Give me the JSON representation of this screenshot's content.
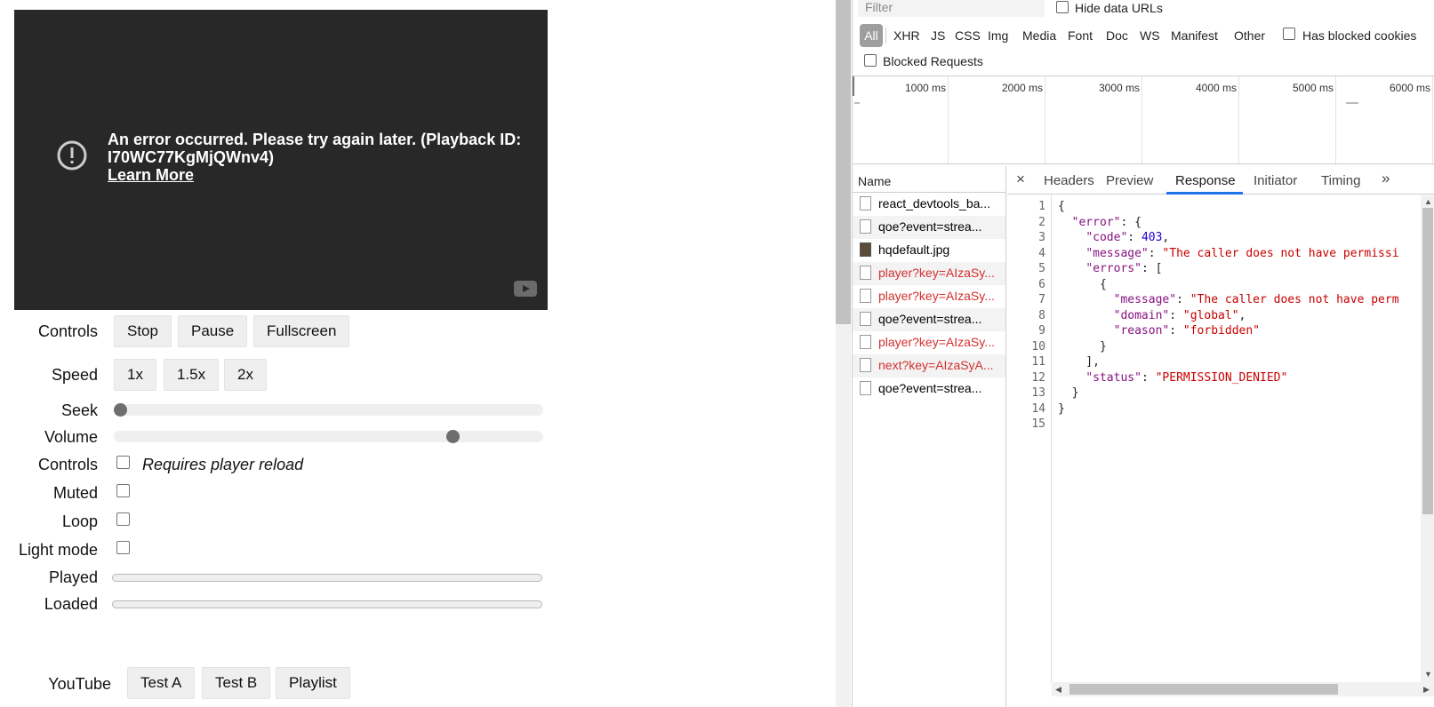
{
  "player": {
    "error_message": "An error occurred. Please try again later. (Playback ID: I70WC77KgMjQWnv4)",
    "learn_more": "Learn More"
  },
  "controls": {
    "label": "Controls",
    "buttons": [
      "Stop",
      "Pause",
      "Fullscreen"
    ]
  },
  "speed": {
    "label": "Speed",
    "buttons": [
      "1x",
      "1.5x",
      "2x"
    ]
  },
  "seek": {
    "label": "Seek",
    "value": 0.0
  },
  "volume": {
    "label": "Volume",
    "value": 0.8
  },
  "checkboxes": [
    {
      "label": "Controls",
      "checked": false,
      "note": "Requires player reload"
    },
    {
      "label": "Muted",
      "checked": false
    },
    {
      "label": "Loop",
      "checked": false
    },
    {
      "label": "Light mode",
      "checked": false
    }
  ],
  "played": {
    "label": "Played",
    "value": 0.0
  },
  "loaded": {
    "label": "Loaded",
    "value": 0.0
  },
  "youtube": {
    "label": "YouTube",
    "buttons": [
      "Test A",
      "Test B",
      "Playlist"
    ]
  },
  "devtools": {
    "filter_placeholder": "Filter",
    "hide_data_urls": "Hide data URLs",
    "types": [
      "All",
      "XHR",
      "JS",
      "CSS",
      "Img",
      "Media",
      "Font",
      "Doc",
      "WS",
      "Manifest",
      "Other"
    ],
    "has_blocked_cookies": "Has blocked cookies",
    "blocked_requests": "Blocked Requests",
    "timeline_labels": [
      "1000 ms",
      "2000 ms",
      "3000 ms",
      "4000 ms",
      "5000 ms",
      "6000 ms"
    ],
    "name_header": "Name",
    "requests": [
      {
        "name": "react_devtools_ba...",
        "error": false,
        "icon": "file-icon"
      },
      {
        "name": "qoe?event=strea...",
        "error": false,
        "icon": "file-icon"
      },
      {
        "name": "hqdefault.jpg",
        "error": false,
        "icon": "image-icon"
      },
      {
        "name": "player?key=AIzaSy...",
        "error": true,
        "icon": "file-icon"
      },
      {
        "name": "player?key=AIzaSy...",
        "error": true,
        "icon": "file-icon"
      },
      {
        "name": "qoe?event=strea...",
        "error": false,
        "icon": "file-icon"
      },
      {
        "name": "player?key=AIzaSy...",
        "error": true,
        "icon": "file-icon"
      },
      {
        "name": "next?key=AIzaSyA...",
        "error": true,
        "icon": "file-icon"
      },
      {
        "name": "qoe?event=strea...",
        "error": false,
        "icon": "file-icon"
      }
    ],
    "tabs": [
      "Headers",
      "Preview",
      "Response",
      "Initiator",
      "Timing"
    ],
    "active_tab": "Response",
    "close_symbol": "×",
    "more_symbol": "»",
    "response_lines": [
      "{",
      "  \"error\": {",
      "    \"code\": 403,",
      "    \"message\": \"The caller does not have permissi",
      "    \"errors\": [",
      "      {",
      "        \"message\": \"The caller does not have perm",
      "        \"domain\": \"global\",",
      "        \"reason\": \"forbidden\"",
      "      }",
      "    ],",
      "    \"status\": \"PERMISSION_DENIED\"",
      "  }",
      "}",
      ""
    ]
  }
}
